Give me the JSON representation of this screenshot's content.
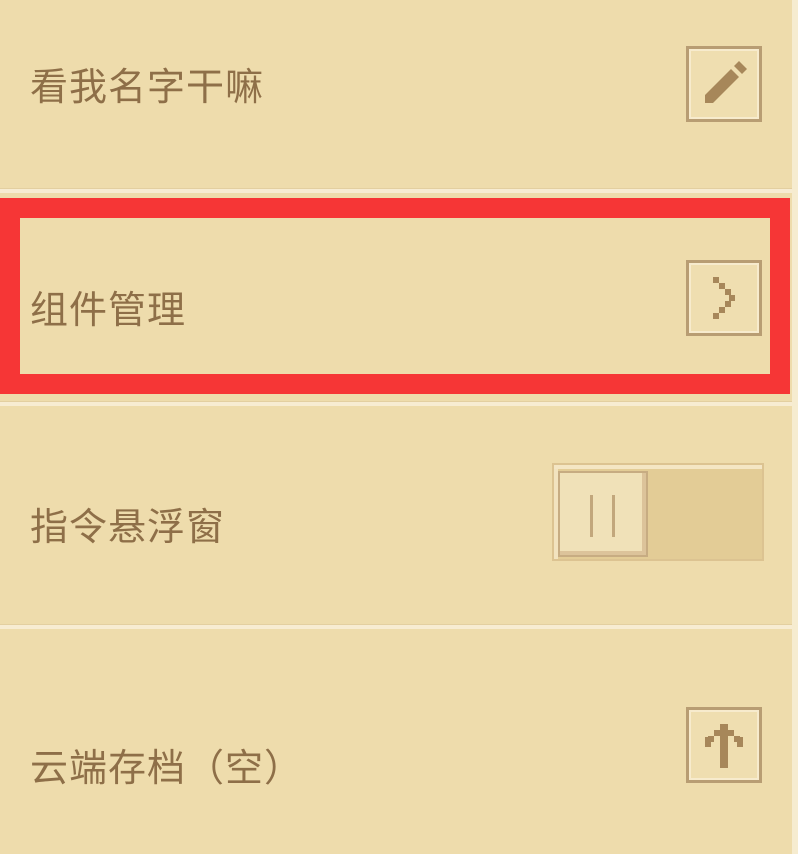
{
  "menu": {
    "items": [
      {
        "label": "看我名字干嘛",
        "action_icon": "pencil-icon"
      },
      {
        "label": "组件管理",
        "action_icon": "chevron-right-icon"
      },
      {
        "label": "指令悬浮窗",
        "toggle_state": "off"
      },
      {
        "label": "云端存档（空）",
        "action_icon": "upload-arrow-icon"
      }
    ]
  },
  "colors": {
    "background": "#eedcac",
    "text": "#8e6f48",
    "highlight": "#f63636",
    "icon": "#a7875a"
  }
}
